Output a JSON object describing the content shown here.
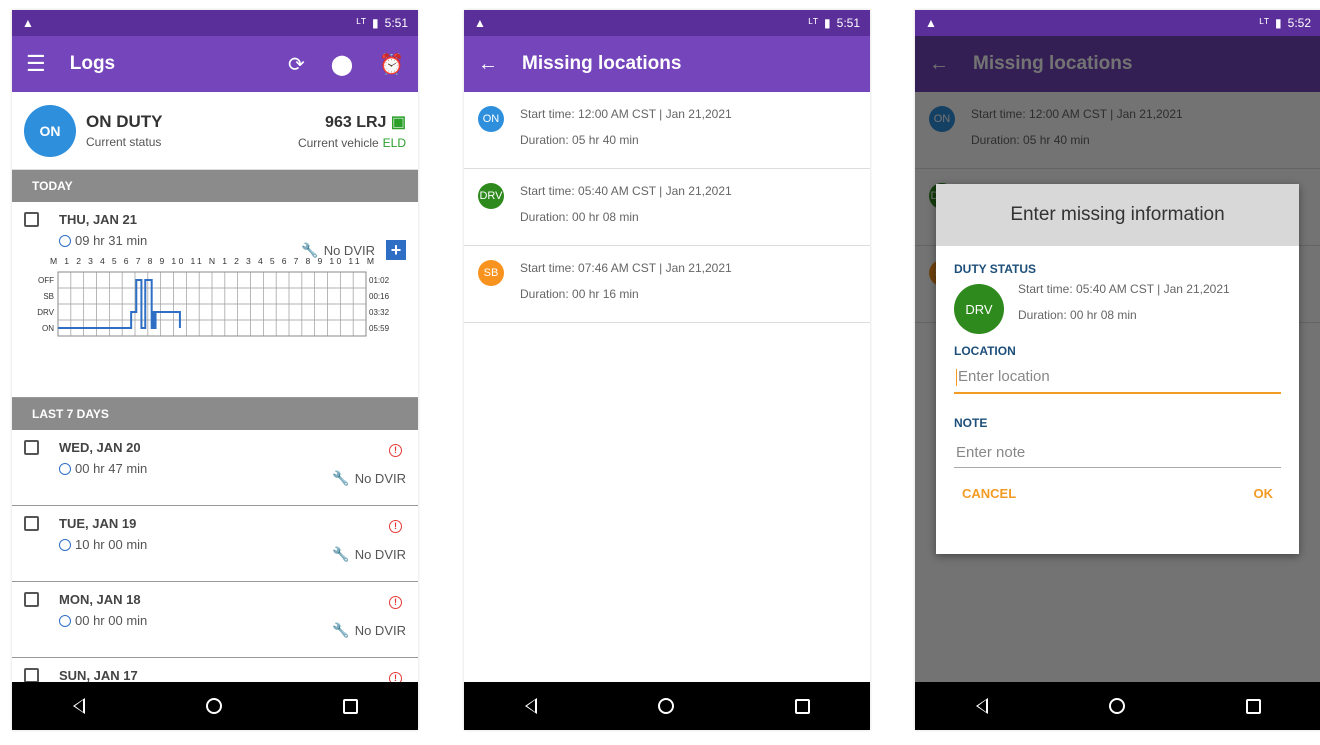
{
  "status_bars": [
    {
      "time": "5:51",
      "signal": "ᴸᵀ"
    },
    {
      "time": "5:51",
      "signal": "ᴸᵀ"
    },
    {
      "time": "5:52",
      "signal": "ᴸᵀ"
    }
  ],
  "logs": {
    "title": "Logs",
    "status": {
      "badge": "ON",
      "title": "ON DUTY",
      "subtitle": "Current status",
      "vehicle": "963 LRJ",
      "vehicle_label": "Current vehicle",
      "eld": "ELD"
    },
    "today_header": "TODAY",
    "today": {
      "date": "THU, JAN 21",
      "duration": "09 hr 31 min",
      "dvir": "No DVIR"
    },
    "chart_data": {
      "type": "line",
      "title": "",
      "hour_labels": "M 1 2 3 4 5 6 7 8 9 10 11 N 1 2 3 4 5 6 7 8 9 10 11 M",
      "status_labels": [
        "OFF",
        "SB",
        "DRV",
        "ON"
      ],
      "totals": [
        "01:02",
        "00:16",
        "03:32",
        "05:59"
      ],
      "series": [
        {
          "values": [
            {
              "hour": 0,
              "status": "ON"
            },
            {
              "hour": 5.7,
              "status": "ON"
            },
            {
              "hour": 5.7,
              "status": "DRV"
            },
            {
              "hour": 6.1,
              "status": "DRV"
            },
            {
              "hour": 6.1,
              "status": "OFF"
            },
            {
              "hour": 6.5,
              "status": "OFF"
            },
            {
              "hour": 6.5,
              "status": "ON"
            },
            {
              "hour": 6.8,
              "status": "ON"
            },
            {
              "hour": 6.8,
              "status": "OFF"
            },
            {
              "hour": 7.3,
              "status": "OFF"
            },
            {
              "hour": 7.3,
              "status": "ON"
            },
            {
              "hour": 7.4,
              "status": "ON"
            },
            {
              "hour": 7.4,
              "status": "DRV"
            },
            {
              "hour": 7.5,
              "status": "DRV"
            },
            {
              "hour": 7.5,
              "status": "ON"
            },
            {
              "hour": 7.6,
              "status": "ON"
            },
            {
              "hour": 7.6,
              "status": "DRV"
            },
            {
              "hour": 9.5,
              "status": "DRV"
            },
            {
              "hour": 9.5,
              "status": "ON"
            }
          ]
        }
      ]
    },
    "last7_header": "LAST 7 DAYS",
    "days": [
      {
        "date": "WED, JAN 20",
        "duration": "00 hr 47 min",
        "dvir": "No DVIR"
      },
      {
        "date": "TUE, JAN 19",
        "duration": "10 hr 00 min",
        "dvir": "No DVIR"
      },
      {
        "date": "MON, JAN 18",
        "duration": "00 hr 00 min",
        "dvir": "No DVIR"
      },
      {
        "date": "SUN, JAN 17",
        "duration": "",
        "dvir": ""
      }
    ]
  },
  "missing": {
    "title": "Missing locations",
    "items": [
      {
        "badge": "ON",
        "color": "#2e8fdd",
        "start": "Start time: 12:00 AM CST | Jan 21,2021",
        "duration": "Duration: 05 hr 40 min"
      },
      {
        "badge": "DRV",
        "color": "#2f8a1e",
        "start": "Start time: 05:40 AM CST | Jan 21,2021",
        "duration": "Duration: 00 hr 08 min"
      },
      {
        "badge": "SB",
        "color": "#f7931e",
        "start": "Start time: 07:46 AM CST | Jan 21,2021",
        "duration": "Duration: 00 hr 16 min"
      }
    ]
  },
  "dialog": {
    "title": "Enter missing information",
    "duty_label": "DUTY STATUS",
    "badge": "DRV",
    "start": "Start time: 05:40 AM CST | Jan 21,2021",
    "duration": "Duration: 00 hr 08 min",
    "location_label": "LOCATION",
    "location_placeholder": "Enter location",
    "note_label": "NOTE",
    "note_placeholder": "Enter note",
    "cancel": "CANCEL",
    "ok": "OK"
  }
}
